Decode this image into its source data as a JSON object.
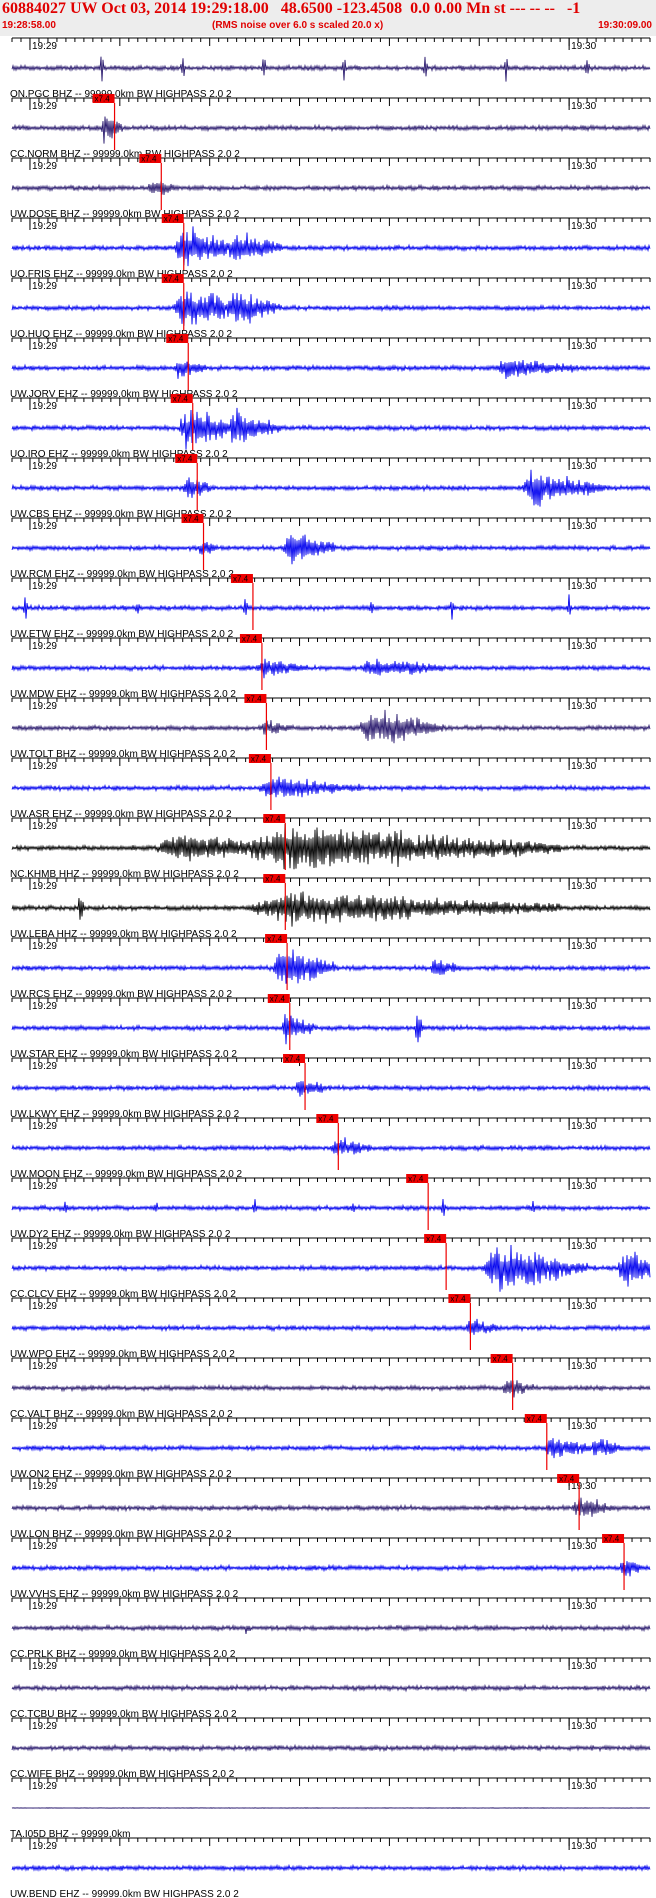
{
  "header": {
    "title": "60884027 UW Oct 03, 2014 19:29:18.00   48.6500 -123.4508  0.0 0.00 Mn st --- -- --   -1",
    "start_time": "19:28:58.00",
    "noise_note": "(RMS noise over 6.0 s scaled 20.0 x)",
    "end_time": "19:30:09.00"
  },
  "pick_label": "x7.4",
  "colors": {
    "header_bg": "#ededed",
    "header_text": "#e00000",
    "blue": "#0000ee",
    "navy": "#2a1a6e",
    "black": "#000000",
    "pick": "#ee0000",
    "grid": "#000000"
  },
  "chart_data": {
    "type": "line",
    "x_start": "19:28:58.00",
    "x_end": "19:30:09.00",
    "minute_labels": [
      "19:29",
      "19:30"
    ],
    "minute_positions_s": [
      2,
      62
    ],
    "traces": [
      {
        "label": "ON.PGC BHZ -- 99999.0km BW  HIGHPASS  2.0  2",
        "color": "navy",
        "pick_s": null,
        "kind": "spikes",
        "events": [
          [
            10,
            0.45
          ],
          [
            19,
            0.4
          ],
          [
            28,
            0.5
          ],
          [
            37,
            0.4
          ],
          [
            46,
            0.4
          ],
          [
            55,
            0.45
          ],
          [
            64,
            0.5
          ]
        ]
      },
      {
        "label": "CC.NORM BHZ -- 99999.0km BW  HIGHPASS  2.0  2",
        "color": "navy",
        "pick_s": 10.3,
        "kind": "noise",
        "events": [
          [
            10.3,
            0.8,
            2
          ]
        ]
      },
      {
        "label": "UW.DOSE BHZ -- 99999.0km BW  HIGHPASS  2.0  2",
        "color": "navy",
        "pick_s": 15.5,
        "kind": "noise",
        "events": [
          [
            15.5,
            0.35,
            3
          ]
        ]
      },
      {
        "label": "UO.FRIS EHZ -- 99999.0km BW  HIGHPASS  2.0  2",
        "color": "blue",
        "pick_s": 18.0,
        "kind": "noise",
        "events": [
          [
            19,
            1.0,
            6
          ],
          [
            25,
            0.7,
            5
          ]
        ]
      },
      {
        "label": "UO.HUQ EHZ -- 99999.0km BW  HIGHPASS  2.0  2",
        "color": "blue",
        "pick_s": 18.0,
        "kind": "noise",
        "events": [
          [
            19,
            1.0,
            6
          ],
          [
            25,
            0.7,
            5
          ]
        ]
      },
      {
        "label": "UW.JORV EHZ -- 99999.0km BW  HIGHPASS  2.0  2",
        "color": "blue",
        "pick_s": 18.5,
        "kind": "noise",
        "events": [
          [
            18.5,
            0.4,
            3
          ],
          [
            55,
            0.4,
            8
          ]
        ]
      },
      {
        "label": "UO.IRO EHZ -- 99999.0km BW  HIGHPASS  2.0  2",
        "color": "blue",
        "pick_s": 19.0,
        "kind": "noise",
        "events": [
          [
            19.5,
            1.0,
            6
          ],
          [
            25,
            0.7,
            5
          ]
        ]
      },
      {
        "label": "UW.CBS EHZ -- 99999.0km BW  HIGHPASS  2.0  2",
        "color": "blue",
        "pick_s": 19.5,
        "kind": "noise",
        "events": [
          [
            19.5,
            0.45,
            3
          ],
          [
            58,
            0.8,
            8
          ]
        ]
      },
      {
        "label": "UW.RCM EHZ -- 99999.0km BW  HIGHPASS  2.0  2",
        "color": "blue",
        "pick_s": 20.2,
        "kind": "noise",
        "events": [
          [
            21,
            0.35,
            2
          ],
          [
            31,
            0.8,
            5
          ]
        ]
      },
      {
        "label": "UW.ETW EHZ -- 99999.0km BW  HIGHPASS  2.0  2",
        "color": "blue",
        "pick_s": 25.7,
        "kind": "spikes",
        "events": [
          [
            1.5,
            0.35
          ],
          [
            14,
            0.3
          ],
          [
            26,
            0.35
          ],
          [
            40,
            0.3
          ],
          [
            49,
            0.35
          ],
          [
            62,
            0.35
          ]
        ]
      },
      {
        "label": "UW.MDW EHZ -- 99999.0km BW  HIGHPASS  2.0  2",
        "color": "blue",
        "pick_s": 26.7,
        "kind": "noise",
        "events": [
          [
            28,
            0.35,
            5
          ],
          [
            40,
            0.4,
            8
          ]
        ]
      },
      {
        "label": "UW.TOLT BHZ -- 99999.0km BW  HIGHPASS  2.0  2",
        "color": "navy",
        "pick_s": 27.2,
        "kind": "noise",
        "events": [
          [
            28,
            0.3,
            3
          ],
          [
            40,
            0.9,
            8
          ]
        ]
      },
      {
        "label": "UW.ASR EHZ -- 99999.0km BW  HIGHPASS  2.0  2",
        "color": "blue",
        "pick_s": 27.7,
        "kind": "noise",
        "events": [
          [
            29,
            0.45,
            10
          ]
        ]
      },
      {
        "label": "NC.KHMB HHZ -- 99999.0km BW  HIGHPASS  2.0  2",
        "color": "black",
        "pick_s": 29.3,
        "kind": "noise",
        "events": [
          [
            18,
            0.6,
            12
          ],
          [
            31,
            1.0,
            30
          ]
        ]
      },
      {
        "label": "UW.LEBA HHZ -- 99999.0km BW  HIGHPASS  2.0  2",
        "color": "black",
        "pick_s": 29.3,
        "kind": "noise",
        "events": [
          [
            7.5,
            0.7,
            0.6
          ],
          [
            31,
            0.7,
            30
          ]
        ]
      },
      {
        "label": "UW.RCS EHZ -- 99999.0km BW  HIGHPASS  2.0  2",
        "color": "blue",
        "pick_s": 29.5,
        "kind": "noise",
        "events": [
          [
            30,
            1.0,
            6
          ],
          [
            47,
            0.4,
            3
          ]
        ]
      },
      {
        "label": "UW.STAR EHZ -- 99999.0km BW  HIGHPASS  2.0  2",
        "color": "blue",
        "pick_s": 29.8,
        "kind": "noise",
        "events": [
          [
            30.5,
            0.75,
            3
          ],
          [
            45,
            0.8,
            0.8
          ]
        ]
      },
      {
        "label": "UW.LKWY EHZ -- 99999.0km BW  HIGHPASS  2.0  2",
        "color": "blue",
        "pick_s": 31.5,
        "kind": "noise",
        "events": [
          [
            32,
            0.4,
            3
          ]
        ]
      },
      {
        "label": "UW.MOON EHZ -- 99999.0km BW  HIGHPASS  2.0  2",
        "color": "blue",
        "pick_s": 35.2,
        "kind": "noise",
        "events": [
          [
            36,
            0.4,
            4
          ]
        ]
      },
      {
        "label": "UW.DY2 EHZ -- 99999.0km BW  HIGHPASS  2.0  2",
        "color": "blue",
        "pick_s": 45.2,
        "kind": "spikes",
        "events": [
          [
            6,
            0.25
          ],
          [
            16,
            0.2
          ],
          [
            27,
            0.25
          ],
          [
            38,
            0.2
          ],
          [
            48,
            0.25
          ],
          [
            58,
            0.2
          ]
        ]
      },
      {
        "label": "CC.CLCV EHZ -- 99999.0km BW  HIGHPASS  2.0  2",
        "color": "blue",
        "pick_s": 47.2,
        "kind": "noise",
        "events": [
          [
            54,
            1.0,
            10
          ],
          [
            68,
            0.9,
            4
          ]
        ]
      },
      {
        "label": "UW.WPO EHZ -- 99999.0km BW  HIGHPASS  2.0  2",
        "color": "blue",
        "pick_s": 49.9,
        "kind": "noise",
        "events": [
          [
            51,
            0.4,
            3
          ]
        ]
      },
      {
        "label": "CC.VALT BHZ -- 99999.0km BW  HIGHPASS  2.0  2",
        "color": "navy",
        "pick_s": 54.6,
        "kind": "noise",
        "events": [
          [
            55,
            0.4,
            3
          ]
        ]
      },
      {
        "label": "UW.ON2 EHZ -- 99999.0km BW  HIGHPASS  2.0  2",
        "color": "blue",
        "pick_s": 58.4,
        "kind": "noise",
        "events": [
          [
            60,
            0.45,
            5
          ],
          [
            65,
            0.5,
            3
          ]
        ]
      },
      {
        "label": "UW.LON BHZ -- 99999.0km BW  HIGHPASS  2.0  2",
        "color": "navy",
        "pick_s": 62.0,
        "kind": "noise",
        "events": [
          [
            63,
            0.5,
            4
          ]
        ]
      },
      {
        "label": "UW.VVHS EHZ -- 99999.0km BW  HIGHPASS  2.0  2",
        "color": "blue",
        "pick_s": 67.0,
        "kind": "noise",
        "events": [
          [
            68,
            0.5,
            2
          ]
        ]
      },
      {
        "label": "CC.PRLK BHZ -- 99999.0km BW  HIGHPASS  2.0  2",
        "color": "navy",
        "pick_s": null,
        "kind": "noise",
        "events": [
          [
            26,
            0.35,
            0.5
          ]
        ]
      },
      {
        "label": "CC.TCBU BHZ -- 99999.0km BW  HIGHPASS  2.0  2",
        "color": "navy",
        "pick_s": null,
        "kind": "noise",
        "events": []
      },
      {
        "label": "CC.WIFE BHZ -- 99999.0km BW  HIGHPASS  2.0  2",
        "color": "navy",
        "pick_s": null,
        "kind": "noise",
        "events": []
      },
      {
        "label": "TA.I05D BHZ -- 99999.0km",
        "color": "navy",
        "pick_s": null,
        "kind": "flat",
        "events": []
      },
      {
        "label": "UW.BEND EHZ -- 99999.0km BW  HIGHPASS  2.0  2",
        "color": "blue",
        "pick_s": null,
        "kind": "noise",
        "events": []
      }
    ]
  }
}
